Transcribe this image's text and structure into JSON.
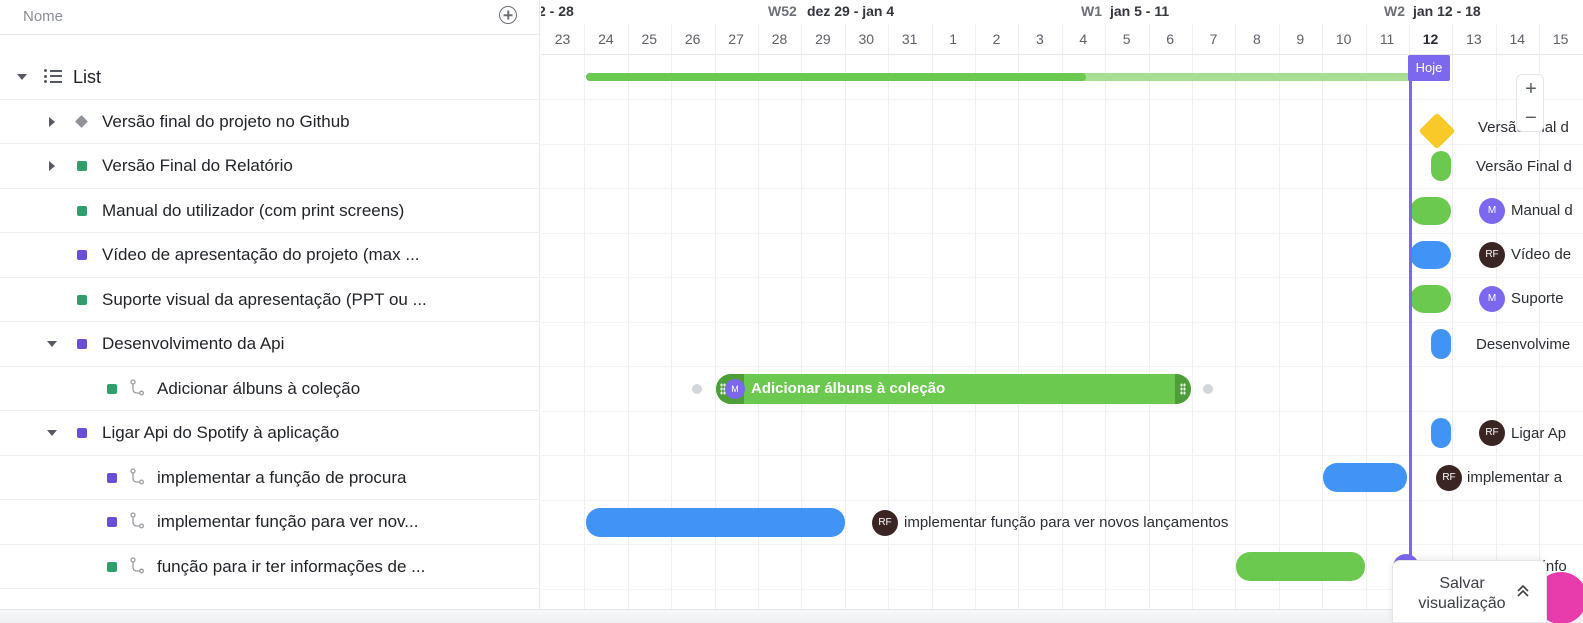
{
  "left_header": {
    "name_label": "Nome"
  },
  "list_row": {
    "label": "List"
  },
  "tasks": [
    {
      "label": "Versão final do projeto no Github"
    },
    {
      "label": "Versão Final do Relatório"
    },
    {
      "label": "Manual do utilizador (com print screens)"
    },
    {
      "label": "Vídeo de apresentação do projeto (max ..."
    },
    {
      "label": "Suporte visual da apresentação (PPT ou ..."
    },
    {
      "label": "Desenvolvimento da Api"
    },
    {
      "label": "Adicionar álbuns à coleção"
    },
    {
      "label": "Ligar Api do Spotify à aplicação"
    },
    {
      "label": "implementar a função de procura"
    },
    {
      "label": "implementar função para ver nov..."
    },
    {
      "label": "função para ir ter informações de ..."
    }
  ],
  "colors": {
    "green_status": "#2f9e6a",
    "purple_status": "#6a4fd6",
    "bar_green": "#6bc950",
    "bar_blue": "#4194f6",
    "today": "#7b68ee",
    "milestone": "#f8c928"
  },
  "timeline": {
    "weeks": [
      {
        "label": "2 - 28"
      },
      {
        "num": "W52",
        "label": "dez 29 - jan 4"
      },
      {
        "num": "W1",
        "label": "jan 5 - 11"
      },
      {
        "num": "W2",
        "label": "jan 12 - 18"
      }
    ],
    "days": [
      "23",
      "24",
      "25",
      "26",
      "27",
      "28",
      "29",
      "30",
      "31",
      "1",
      "2",
      "3",
      "4",
      "5",
      "6",
      "7",
      "8",
      "9",
      "10",
      "11",
      "12",
      "13",
      "14",
      "15"
    ],
    "today_label": "Hoje",
    "zoom_in": "+",
    "zoom_out": "−",
    "bar_labels": {
      "milestone": "Versão final d",
      "relatorio": "Versão Final d",
      "manual": "Manual d",
      "video": "Vídeo de",
      "suporte": "Suporte",
      "desenvolvimento": "Desenvolvime",
      "adicionar": "Adicionar álbuns à coleção",
      "ligar": "Ligar Ap",
      "procura": "implementar a",
      "lancamentos": "implementar função para ver novos lançamentos",
      "informacoes": "função para ir ter info"
    },
    "avatars": {
      "m": "M",
      "rf": "RF"
    }
  },
  "save_view": {
    "label": "Salvar visualização",
    "icon": "chevrons-up-icon"
  }
}
